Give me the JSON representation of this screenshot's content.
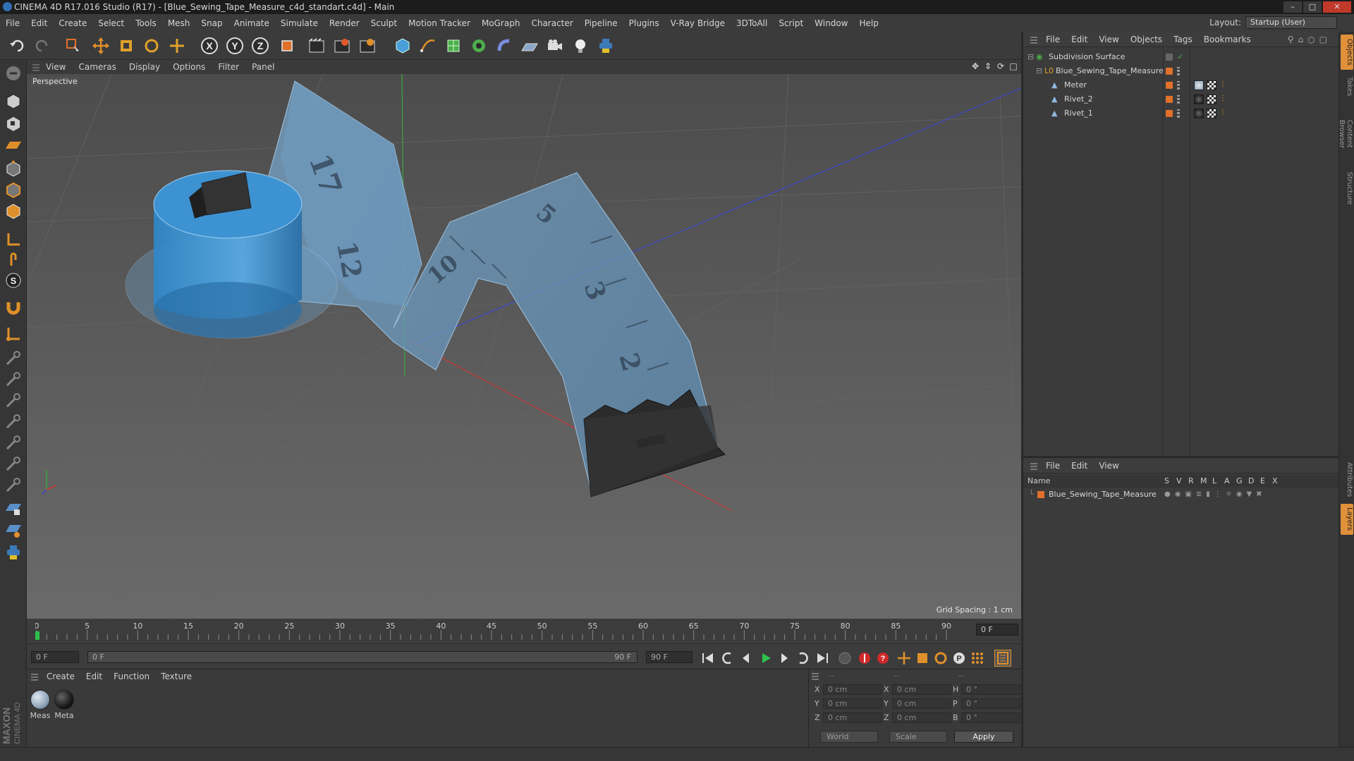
{
  "window": {
    "title": "CINEMA 4D R17.016 Studio (R17) - [Blue_Sewing_Tape_Measure_c4d_standart.c4d] - Main"
  },
  "menubar": [
    "File",
    "Edit",
    "Create",
    "Select",
    "Tools",
    "Mesh",
    "Snap",
    "Animate",
    "Simulate",
    "Render",
    "Sculpt",
    "Motion Tracker",
    "MoGraph",
    "Character",
    "Pipeline",
    "Plugins",
    "V-Ray Bridge",
    "3DToAll",
    "Script",
    "Window",
    "Help"
  ],
  "layout": {
    "label": "Layout:",
    "value": "Startup (User)"
  },
  "viewport": {
    "menu": [
      "View",
      "Cameras",
      "Display",
      "Options",
      "Filter",
      "Panel"
    ],
    "label": "Perspective",
    "grid_spacing": "Grid Spacing : 1 cm"
  },
  "timeline": {
    "ticks": [
      "0",
      "5",
      "10",
      "15",
      "20",
      "25",
      "30",
      "35",
      "40",
      "45",
      "50",
      "55",
      "60",
      "65",
      "70",
      "75",
      "80",
      "85",
      "90"
    ],
    "current_frame": "0 F"
  },
  "transport": {
    "start_field": "0 F",
    "range_start": "0 F",
    "range_end": "90 F",
    "end_field": "90 F"
  },
  "materials": {
    "menu": [
      "Create",
      "Edit",
      "Function",
      "Texture"
    ],
    "items": [
      {
        "label": "Meas",
        "color": "#8fa4b8"
      },
      {
        "label": "Meta",
        "color": "#1a1a1a"
      }
    ]
  },
  "coordinates": {
    "headers": [
      "--",
      "--",
      "--"
    ],
    "rows": [
      {
        "a_label": "X",
        "a_val": "0 cm",
        "b_label": "X",
        "b_val": "0 cm",
        "c_label": "H",
        "c_val": "0 °"
      },
      {
        "a_label": "Y",
        "a_val": "0 cm",
        "b_label": "Y",
        "b_val": "0 cm",
        "c_label": "P",
        "c_val": "0 °"
      },
      {
        "a_label": "Z",
        "a_val": "0 cm",
        "b_label": "Z",
        "b_val": "0 cm",
        "c_label": "B",
        "c_val": "0 °"
      }
    ],
    "mode": "World",
    "scale": "Scale",
    "apply": "Apply"
  },
  "object_manager": {
    "menu": [
      "File",
      "Edit",
      "View",
      "Objects",
      "Tags",
      "Bookmarks"
    ],
    "objects": [
      {
        "name": "Subdivision Surface",
        "level": 0
      },
      {
        "name": "Blue_Sewing_Tape_Measure",
        "level": 1
      },
      {
        "name": "Meter",
        "level": 2
      },
      {
        "name": "Rivet_2",
        "level": 2
      },
      {
        "name": "Rivet_1",
        "level": 2
      }
    ]
  },
  "layer_manager": {
    "menu": [
      "File",
      "Edit",
      "View"
    ],
    "columns": [
      "Name",
      "S",
      "V",
      "R",
      "M",
      "L",
      "A",
      "G",
      "D",
      "E",
      "X"
    ],
    "layers": [
      {
        "name": "Blue_Sewing_Tape_Measure",
        "color": "#e0702a"
      }
    ]
  },
  "right_tabs": [
    "Objects",
    "Takes",
    "Content Browser",
    "Structure",
    "Attributes",
    "Layers"
  ],
  "colors": {
    "accent_orange": "#e0702a",
    "tape_blue": "#4a9fd8",
    "viewport_bg": "#5a5a5a"
  }
}
